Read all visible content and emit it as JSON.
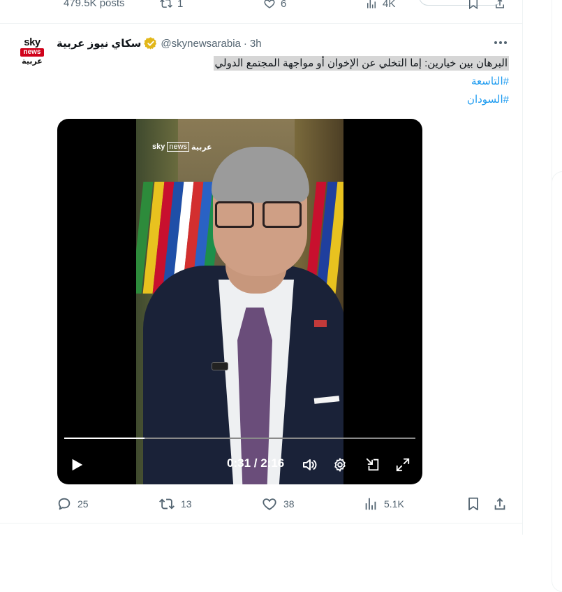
{
  "previous_tweet": {
    "posts_count": "479.5K posts",
    "retweets": "1",
    "likes": "6",
    "views": "4K"
  },
  "tweet": {
    "author_name": "سكاي نيوز عربية",
    "handle": "@skynewsarabia",
    "separator": "·",
    "time": "3h",
    "text": "البرهان بين خيارين: إما التخلي عن الإخوان أو مواجهة المجتمع الدولي",
    "hashtags": [
      "#التاسعة",
      "#السودان"
    ],
    "avatar": {
      "logo_top": "sky",
      "logo_mid": "news",
      "logo_bottom": "عربية"
    }
  },
  "video": {
    "watermark": {
      "sky": "sky",
      "news": "news",
      "arabic": "عربية"
    },
    "current_time": "0:31",
    "duration": "2:16",
    "time_separator": " / ",
    "progress": 0.228
  },
  "actions": {
    "replies": "25",
    "retweets": "13",
    "likes": "38",
    "views": "5.1K"
  },
  "colors": {
    "accent": "#1d9bf0",
    "text_secondary": "#536471",
    "verified_gold": "#e2b719",
    "highlight": "#d6d6d6"
  }
}
